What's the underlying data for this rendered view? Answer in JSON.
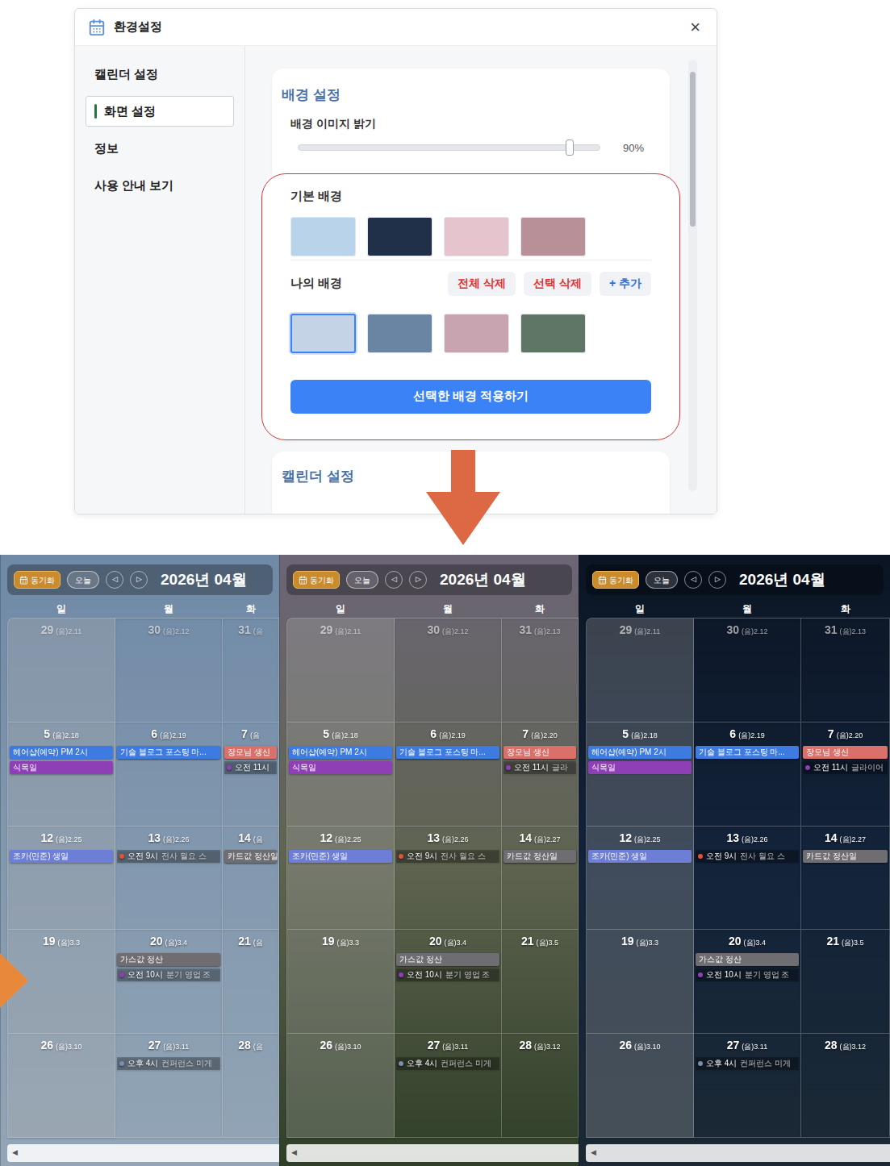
{
  "dialog": {
    "title": "환경설정",
    "close": "×",
    "sidebar": [
      {
        "label": "캘린더 설정",
        "selected": false
      },
      {
        "label": "화면 설정",
        "selected": true
      },
      {
        "label": "정보",
        "selected": false
      },
      {
        "label": "사용 안내 보기",
        "selected": false
      }
    ],
    "background_card": {
      "title": "배경 설정",
      "brightness_label": "배경 이미지 밝기",
      "brightness_level": 0.9,
      "brightness_reading": "90%",
      "default_title": "기본 배경",
      "default_backgrounds": [
        {
          "selected": false,
          "color": "#b9d3ea"
        },
        {
          "selected": false,
          "color": "#1f3048"
        },
        {
          "selected": false,
          "color": "#e6c4cd"
        },
        {
          "selected": false,
          "color": "#b89098"
        }
      ],
      "mine_title": "나의 배경",
      "mine_buttons": [
        {
          "label": "전체 삭제",
          "color": "#e03131"
        },
        {
          "label": "선택 삭제",
          "color": "#e03131"
        },
        {
          "label": "+ 추가",
          "color": "#2f6fe0"
        }
      ],
      "mine_backgrounds": [
        {
          "selected": true,
          "color": "#c4d4e6"
        },
        {
          "selected": false,
          "color": "#6a85a3"
        },
        {
          "selected": false,
          "color": "#c7a4b0"
        },
        {
          "selected": false,
          "color": "#5f7566"
        }
      ],
      "apply_button": "선택한 배경 적용하기"
    },
    "calendar_card": {
      "title": "캘린더 설정"
    }
  },
  "panels": [
    {
      "sync": "동기화",
      "today": "오늘",
      "prev": "◁",
      "next": "▷",
      "month": "2026년 04월",
      "weekdays": [
        "일",
        "월",
        "화"
      ],
      "scroll": "◀",
      "weeks": [
        [
          {
            "day": "29",
            "lunar": "(음)2.11",
            "other_month": true,
            "events": []
          },
          {
            "day": "30",
            "lunar": "(음)2.12",
            "other_month": true,
            "events": []
          },
          {
            "day": "31",
            "lunar": "(음",
            "other_month": true,
            "events": []
          }
        ],
        [
          {
            "day": "5",
            "lunar": "(음)2.18",
            "other_month": false,
            "events": [
              {
                "kind": "bar",
                "title": "헤어샵(예약) PM 2시",
                "color": "#3d7be0"
              },
              {
                "kind": "bar",
                "title": "식목일",
                "color": "#8e3fb5"
              }
            ]
          },
          {
            "day": "6",
            "lunar": "(음)2.19",
            "other_month": false,
            "events": [
              {
                "kind": "bar",
                "title": "기술 블로그 포스팅 마...",
                "color": "#3d7be0"
              }
            ]
          },
          {
            "day": "7",
            "lunar": "(음",
            "other_month": false,
            "events": [
              {
                "kind": "bar",
                "title": "장모님 생신",
                "color": "#d9706a"
              },
              {
                "kind": "timed",
                "time": "오전 11시",
                "color": "#8e3fb5"
              }
            ]
          }
        ],
        [
          {
            "day": "12",
            "lunar": "(음)2.25",
            "other_month": false,
            "events": [
              {
                "kind": "bar",
                "title": "조카(민준) 생일",
                "color": "#6c7ed6"
              }
            ]
          },
          {
            "day": "13",
            "lunar": "(음)2.26",
            "other_month": false,
            "events": [
              {
                "kind": "timed",
                "time": "오전 9시",
                "title": "전사 월요 스",
                "color": "#e0523a"
              }
            ]
          },
          {
            "day": "14",
            "lunar": "(음",
            "other_month": false,
            "events": [
              {
                "kind": "bar",
                "title": "카드값 정산일",
                "color": "#6e6e72"
              }
            ]
          }
        ],
        [
          {
            "day": "19",
            "lunar": "(음)3.3",
            "other_month": false,
            "events": []
          },
          {
            "day": "20",
            "lunar": "(음)3.4",
            "other_month": false,
            "events": [
              {
                "kind": "bar",
                "title": "가스값 정산",
                "color": "#6e6e72"
              },
              {
                "kind": "timed",
                "time": "오전 10시",
                "title": "분기 영업 조",
                "color": "#8e3fb5"
              }
            ]
          },
          {
            "day": "21",
            "lunar": "(음",
            "other_month": false,
            "events": []
          }
        ],
        [
          {
            "day": "26",
            "lunar": "(음)3.10",
            "other_month": false,
            "events": []
          },
          {
            "day": "27",
            "lunar": "(음)3.11",
            "other_month": false,
            "events": [
              {
                "kind": "timed",
                "time": "오후 4시",
                "title": "컨퍼런스 미게",
                "color": "#7a8db0"
              }
            ]
          },
          {
            "day": "28",
            "lunar": "(음",
            "other_month": false,
            "events": []
          }
        ]
      ]
    },
    {
      "sync": "동기화",
      "today": "오늘",
      "prev": "◁",
      "next": "▷",
      "month": "2026년 04월",
      "weekdays": [
        "일",
        "월",
        "화"
      ],
      "scroll": "◀",
      "weeks": [
        [
          {
            "day": "29",
            "lunar": "(음)2.11",
            "other_month": true,
            "events": []
          },
          {
            "day": "30",
            "lunar": "(음)2.12",
            "other_month": true,
            "events": []
          },
          {
            "day": "31",
            "lunar": "(음)2.13",
            "other_month": true,
            "events": []
          }
        ],
        [
          {
            "day": "5",
            "lunar": "(음)2.18",
            "other_month": false,
            "events": [
              {
                "kind": "bar",
                "title": "헤어샵(예약) PM 2시",
                "color": "#3d7be0"
              },
              {
                "kind": "bar",
                "title": "식목일",
                "color": "#8e3fb5"
              }
            ]
          },
          {
            "day": "6",
            "lunar": "(음)2.19",
            "other_month": false,
            "events": [
              {
                "kind": "bar",
                "title": "기술 블로그 포스팅 마...",
                "color": "#3d7be0"
              }
            ]
          },
          {
            "day": "7",
            "lunar": "(음)2.20",
            "other_month": false,
            "events": [
              {
                "kind": "bar",
                "title": "장모님 생신",
                "color": "#d9706a"
              },
              {
                "kind": "timed",
                "time": "오전 11시",
                "title": "글라",
                "color": "#8e3fb5"
              }
            ]
          }
        ],
        [
          {
            "day": "12",
            "lunar": "(음)2.25",
            "other_month": false,
            "events": [
              {
                "kind": "bar",
                "title": "조카(민준) 생일",
                "color": "#6c7ed6"
              }
            ]
          },
          {
            "day": "13",
            "lunar": "(음)2.26",
            "other_month": false,
            "events": [
              {
                "kind": "timed",
                "time": "오전 9시",
                "title": "전사 월요 스",
                "color": "#e0523a"
              }
            ]
          },
          {
            "day": "14",
            "lunar": "(음)2.27",
            "other_month": false,
            "events": [
              {
                "kind": "bar",
                "title": "카드값 정산일",
                "color": "#6e6e72"
              }
            ]
          }
        ],
        [
          {
            "day": "19",
            "lunar": "(음)3.3",
            "other_month": false,
            "events": []
          },
          {
            "day": "20",
            "lunar": "(음)3.4",
            "other_month": false,
            "events": [
              {
                "kind": "bar",
                "title": "가스값 정산",
                "color": "#6e6e72"
              },
              {
                "kind": "timed",
                "time": "오전 10시",
                "title": "분기 영업 조",
                "color": "#8e3fb5"
              }
            ]
          },
          {
            "day": "21",
            "lunar": "(음)3.5",
            "other_month": false,
            "events": []
          }
        ],
        [
          {
            "day": "26",
            "lunar": "(음)3.10",
            "other_month": false,
            "events": []
          },
          {
            "day": "27",
            "lunar": "(음)3.11",
            "other_month": false,
            "events": [
              {
                "kind": "timed",
                "time": "오후 4시",
                "title": "컨퍼런스 미게",
                "color": "#7a8db0"
              }
            ]
          },
          {
            "day": "28",
            "lunar": "(음)3.12",
            "other_month": false,
            "events": []
          }
        ]
      ]
    },
    {
      "sync": "동기화",
      "today": "오늘",
      "prev": "◁",
      "next": "▷",
      "month": "2026년 04월",
      "weekdays": [
        "일",
        "월",
        "화"
      ],
      "scroll": "◀",
      "weeks": [
        [
          {
            "day": "29",
            "lunar": "(음)2.11",
            "other_month": true,
            "events": []
          },
          {
            "day": "30",
            "lunar": "(음)2.12",
            "other_month": true,
            "events": []
          },
          {
            "day": "31",
            "lunar": "(음)2.13",
            "other_month": true,
            "events": []
          }
        ],
        [
          {
            "day": "5",
            "lunar": "(음)2.18",
            "other_month": false,
            "events": [
              {
                "kind": "bar",
                "title": "헤어샵(예약) PM 2시",
                "color": "#3d7be0"
              },
              {
                "kind": "bar",
                "title": "식목일",
                "color": "#8e3fb5"
              }
            ]
          },
          {
            "day": "6",
            "lunar": "(음)2.19",
            "other_month": false,
            "events": [
              {
                "kind": "bar",
                "title": "기술 블로그 포스팅 마...",
                "color": "#3d7be0"
              }
            ]
          },
          {
            "day": "7",
            "lunar": "(음)2.20",
            "other_month": false,
            "events": [
              {
                "kind": "bar",
                "title": "장모님 생신",
                "color": "#d9706a"
              },
              {
                "kind": "timed",
                "time": "오전 11시",
                "title": "글라이어",
                "color": "#8e3fb5"
              }
            ]
          }
        ],
        [
          {
            "day": "12",
            "lunar": "(음)2.25",
            "other_month": false,
            "events": [
              {
                "kind": "bar",
                "title": "조카(민준) 생일",
                "color": "#6c7ed6"
              }
            ]
          },
          {
            "day": "13",
            "lunar": "(음)2.26",
            "other_month": false,
            "events": [
              {
                "kind": "timed",
                "time": "오전 9시",
                "title": "전사 월요 스",
                "color": "#e0523a"
              }
            ]
          },
          {
            "day": "14",
            "lunar": "(음)2.27",
            "other_month": false,
            "events": [
              {
                "kind": "bar",
                "title": "카드값 정산일",
                "color": "#6e6e72"
              }
            ]
          }
        ],
        [
          {
            "day": "19",
            "lunar": "(음)3.3",
            "other_month": false,
            "events": []
          },
          {
            "day": "20",
            "lunar": "(음)3.4",
            "other_month": false,
            "events": [
              {
                "kind": "bar",
                "title": "가스값 정산",
                "color": "#6e6e72"
              },
              {
                "kind": "timed",
                "time": "오전 10시",
                "title": "분기 영업 조",
                "color": "#8e3fb5"
              }
            ]
          },
          {
            "day": "21",
            "lunar": "(음)3.5",
            "other_month": false,
            "events": []
          }
        ],
        [
          {
            "day": "26",
            "lunar": "(음)3.10",
            "other_month": false,
            "events": []
          },
          {
            "day": "27",
            "lunar": "(음)3.11",
            "other_month": false,
            "events": [
              {
                "kind": "timed",
                "time": "오후 4시",
                "title": "컨퍼런스 미게",
                "color": "#7a8db0"
              }
            ]
          },
          {
            "day": "28",
            "lunar": "(음)3.12",
            "other_month": false,
            "events": []
          }
        ]
      ]
    }
  ]
}
